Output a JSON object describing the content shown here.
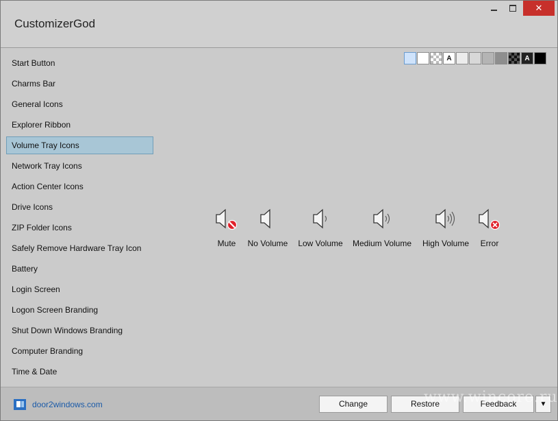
{
  "window": {
    "title": "CustomizerGod",
    "close_symbol": "✕"
  },
  "sidebar": {
    "items": [
      {
        "label": "Start Button"
      },
      {
        "label": "Charms Bar"
      },
      {
        "label": "General Icons"
      },
      {
        "label": "Explorer Ribbon"
      },
      {
        "label": "Volume Tray Icons",
        "selected": true
      },
      {
        "label": "Network Tray Icons"
      },
      {
        "label": "Action Center Icons"
      },
      {
        "label": "Drive Icons"
      },
      {
        "label": "ZIP Folder Icons"
      },
      {
        "label": "Safely Remove Hardware Tray Icon"
      },
      {
        "label": "Battery"
      },
      {
        "label": "Login Screen"
      },
      {
        "label": "Logon Screen Branding"
      },
      {
        "label": "Shut Down Windows Branding"
      },
      {
        "label": "Computer Branding"
      },
      {
        "label": "Time & Date"
      }
    ]
  },
  "swatches": [
    {
      "name": "light-blue",
      "color": "#cfe3fb",
      "selected": true
    },
    {
      "name": "white",
      "color": "#ffffff"
    },
    {
      "name": "checker",
      "color": "#f0f0f0"
    },
    {
      "name": "letter-a-light",
      "color": "#ffffff",
      "text": "A"
    },
    {
      "name": "very-light-gray",
      "color": "#ececec"
    },
    {
      "name": "light-gray",
      "color": "#d8d8d8"
    },
    {
      "name": "gray",
      "color": "#b4b4b4"
    },
    {
      "name": "dark-gray",
      "color": "#8e8e8e"
    },
    {
      "name": "dark-checker",
      "color": "#3a3a3a"
    },
    {
      "name": "letter-a-dark",
      "color": "#222222",
      "text": "A"
    },
    {
      "name": "black",
      "color": "#000000"
    }
  ],
  "volume_icons": [
    {
      "label": "Mute",
      "icon": "speaker-mute-icon"
    },
    {
      "label": "No Volume",
      "icon": "speaker-icon"
    },
    {
      "label": "Low Volume",
      "icon": "speaker-low-icon"
    },
    {
      "label": "Medium Volume",
      "icon": "speaker-medium-icon"
    },
    {
      "label": "High Volume",
      "icon": "speaker-high-icon"
    },
    {
      "label": "Error",
      "icon": "speaker-error-icon"
    }
  ],
  "footer": {
    "brand": "door2windows.com",
    "change_label": "Change",
    "restore_label": "Restore",
    "feedback_label": "Feedback",
    "dropdown_symbol": "▼"
  },
  "watermark": "www.wincore.ru",
  "colors": {
    "selection_bg": "#a8c6d6",
    "close_red": "#c7302b",
    "link_blue": "#1a5aa8",
    "error_red": "#e0202a"
  }
}
